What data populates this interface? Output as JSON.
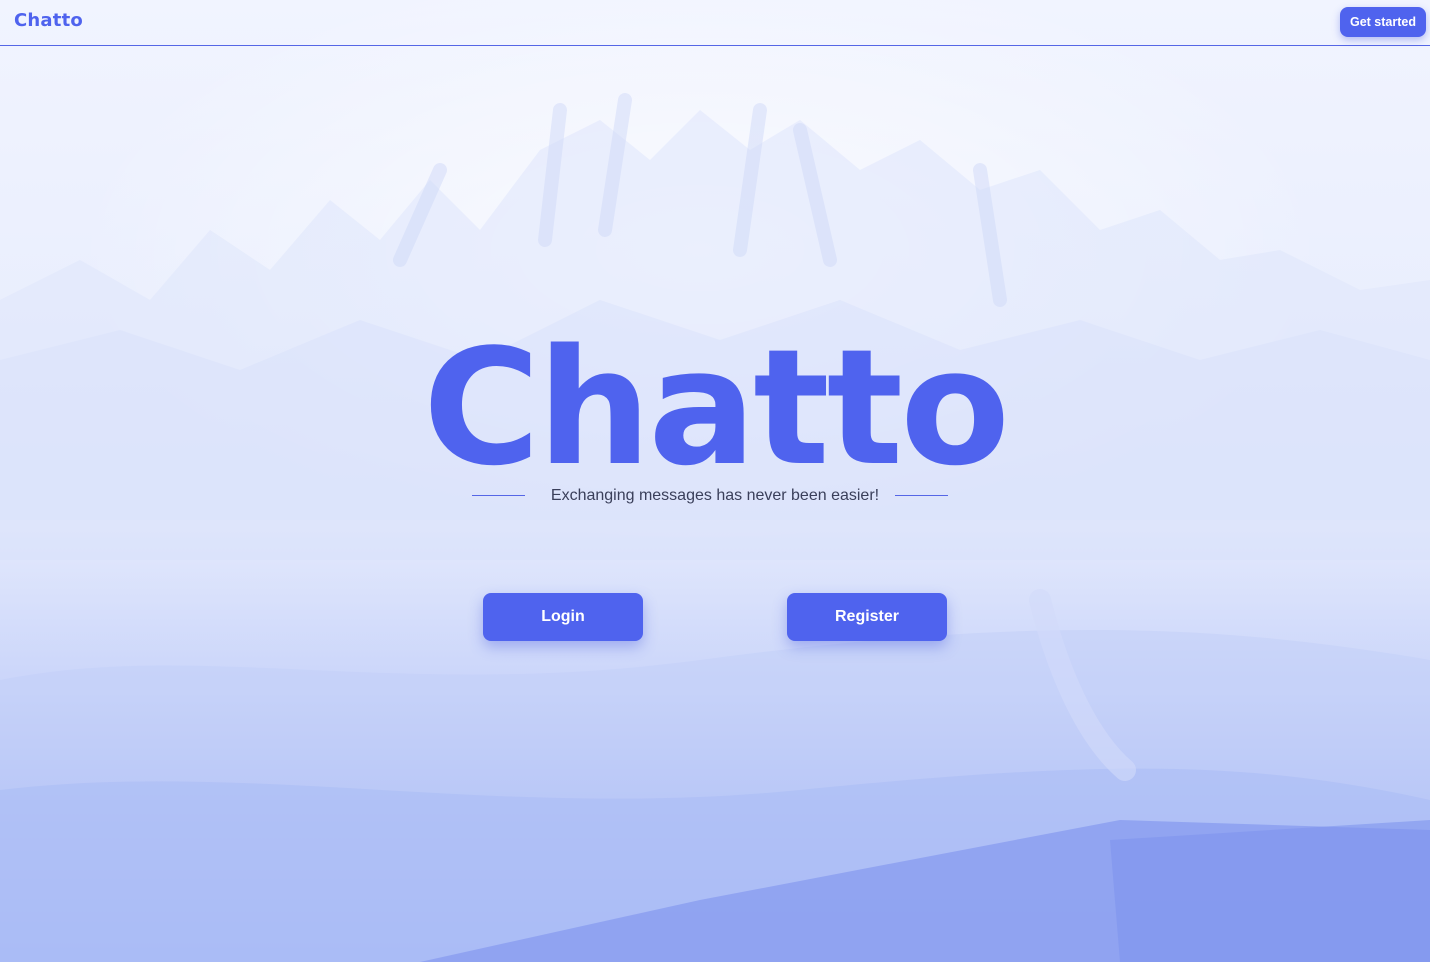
{
  "header": {
    "brand": "Chatto",
    "get_started_label": "Get started"
  },
  "hero": {
    "title": "Chatto",
    "subtitle": "Exchanging messages has never been easier!"
  },
  "actions": {
    "login_label": "Login",
    "register_label": "Register"
  },
  "colors": {
    "accent": "#4f63ee",
    "background": "#eef2fe"
  }
}
